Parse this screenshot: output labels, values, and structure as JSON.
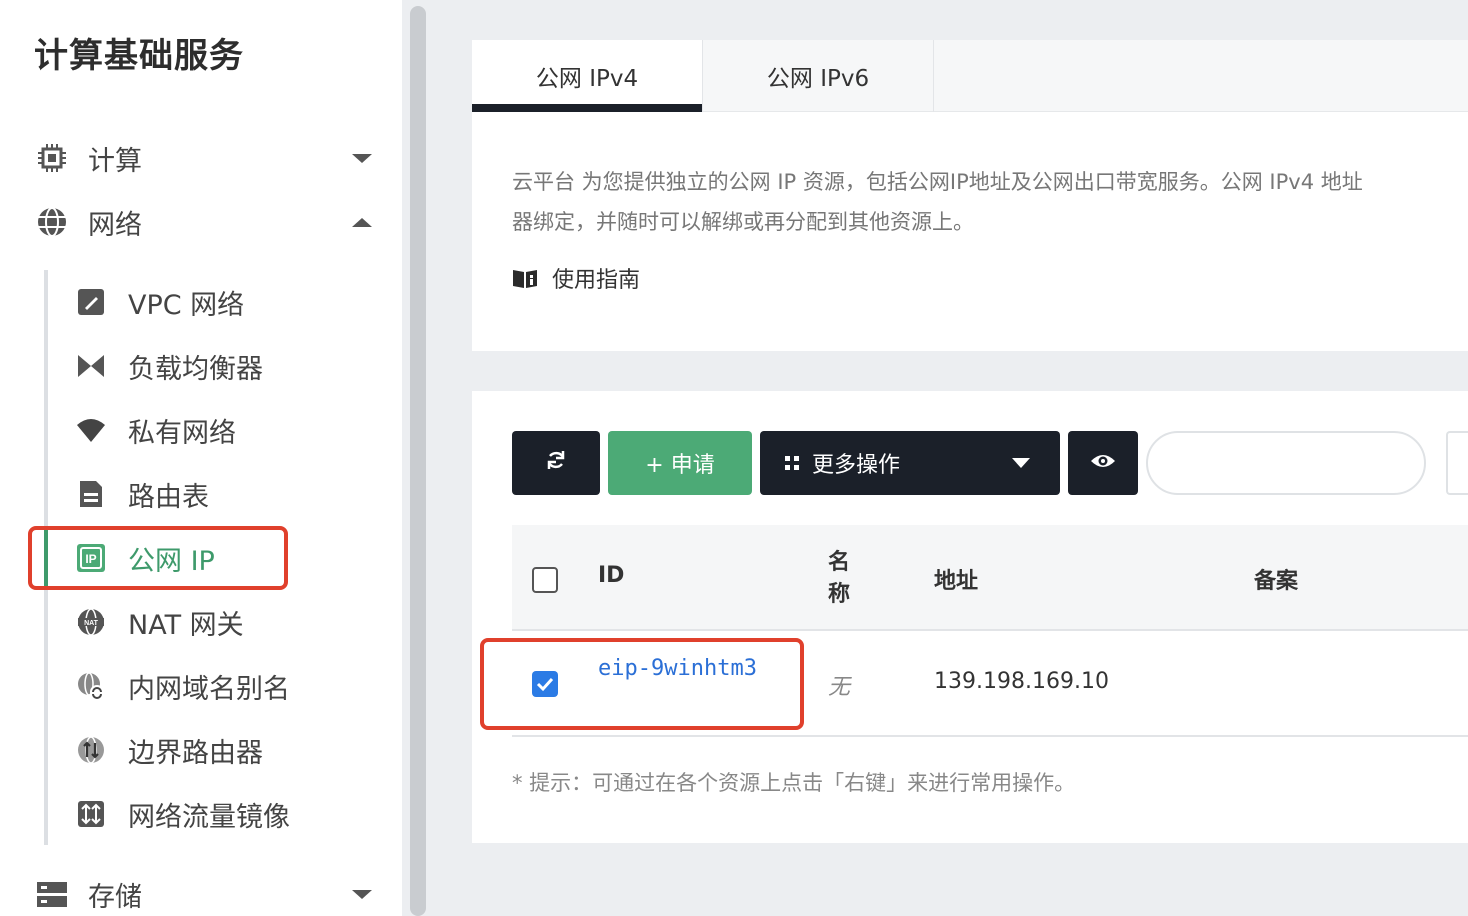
{
  "sidebar": {
    "title": "计算基础服务",
    "groups": {
      "compute": {
        "label": "计算",
        "icon": "chip-icon"
      },
      "network": {
        "label": "网络",
        "icon": "globe-icon"
      },
      "storage": {
        "label": "存储",
        "icon": "storage-icon"
      }
    },
    "network_items": [
      {
        "label": "VPC 网络",
        "icon": "vpc-icon"
      },
      {
        "label": "负载均衡器",
        "icon": "load-balancer-icon"
      },
      {
        "label": "私有网络",
        "icon": "wifi-icon"
      },
      {
        "label": "路由表",
        "icon": "route-table-icon"
      },
      {
        "label": "公网 IP",
        "icon": "ip-icon",
        "active": true
      },
      {
        "label": "NAT 网关",
        "icon": "nat-icon"
      },
      {
        "label": "内网域名别名",
        "icon": "dns-alias-icon"
      },
      {
        "label": "边界路由器",
        "icon": "border-router-icon"
      },
      {
        "label": "网络流量镜像",
        "icon": "traffic-mirror-icon"
      }
    ]
  },
  "tabs": [
    {
      "label": "公网 IPv4",
      "active": true
    },
    {
      "label": "公网 IPv6",
      "active": false
    }
  ],
  "description": {
    "line1": "云平台 为您提供独立的公网 IP 资源，包括公网IP地址及公网出口带宽服务。公网 IPv4 地址",
    "line2": "器绑定，并随时可以解绑或再分配到其他资源上。",
    "guide_label": "使用指南"
  },
  "toolbar": {
    "refresh_icon": "refresh-icon",
    "apply_label": "+ 申请",
    "more_label": "更多操作",
    "eye_icon": "eye-icon",
    "search_placeholder": ""
  },
  "table": {
    "headers": {
      "id": "ID",
      "name": "名称",
      "address": "地址",
      "filing": "备案"
    },
    "rows": [
      {
        "id": "eip-9winhtm3",
        "name": "无",
        "address": "139.198.169.10",
        "checked": true
      }
    ]
  },
  "hint": "* 提示：可通过在各个资源上点击「右键」来进行常用操作。",
  "colors": {
    "accent_green": "#4caa76",
    "dark": "#1b2029",
    "link_blue": "#2b6fd6",
    "highlight_red": "#e0402c"
  }
}
